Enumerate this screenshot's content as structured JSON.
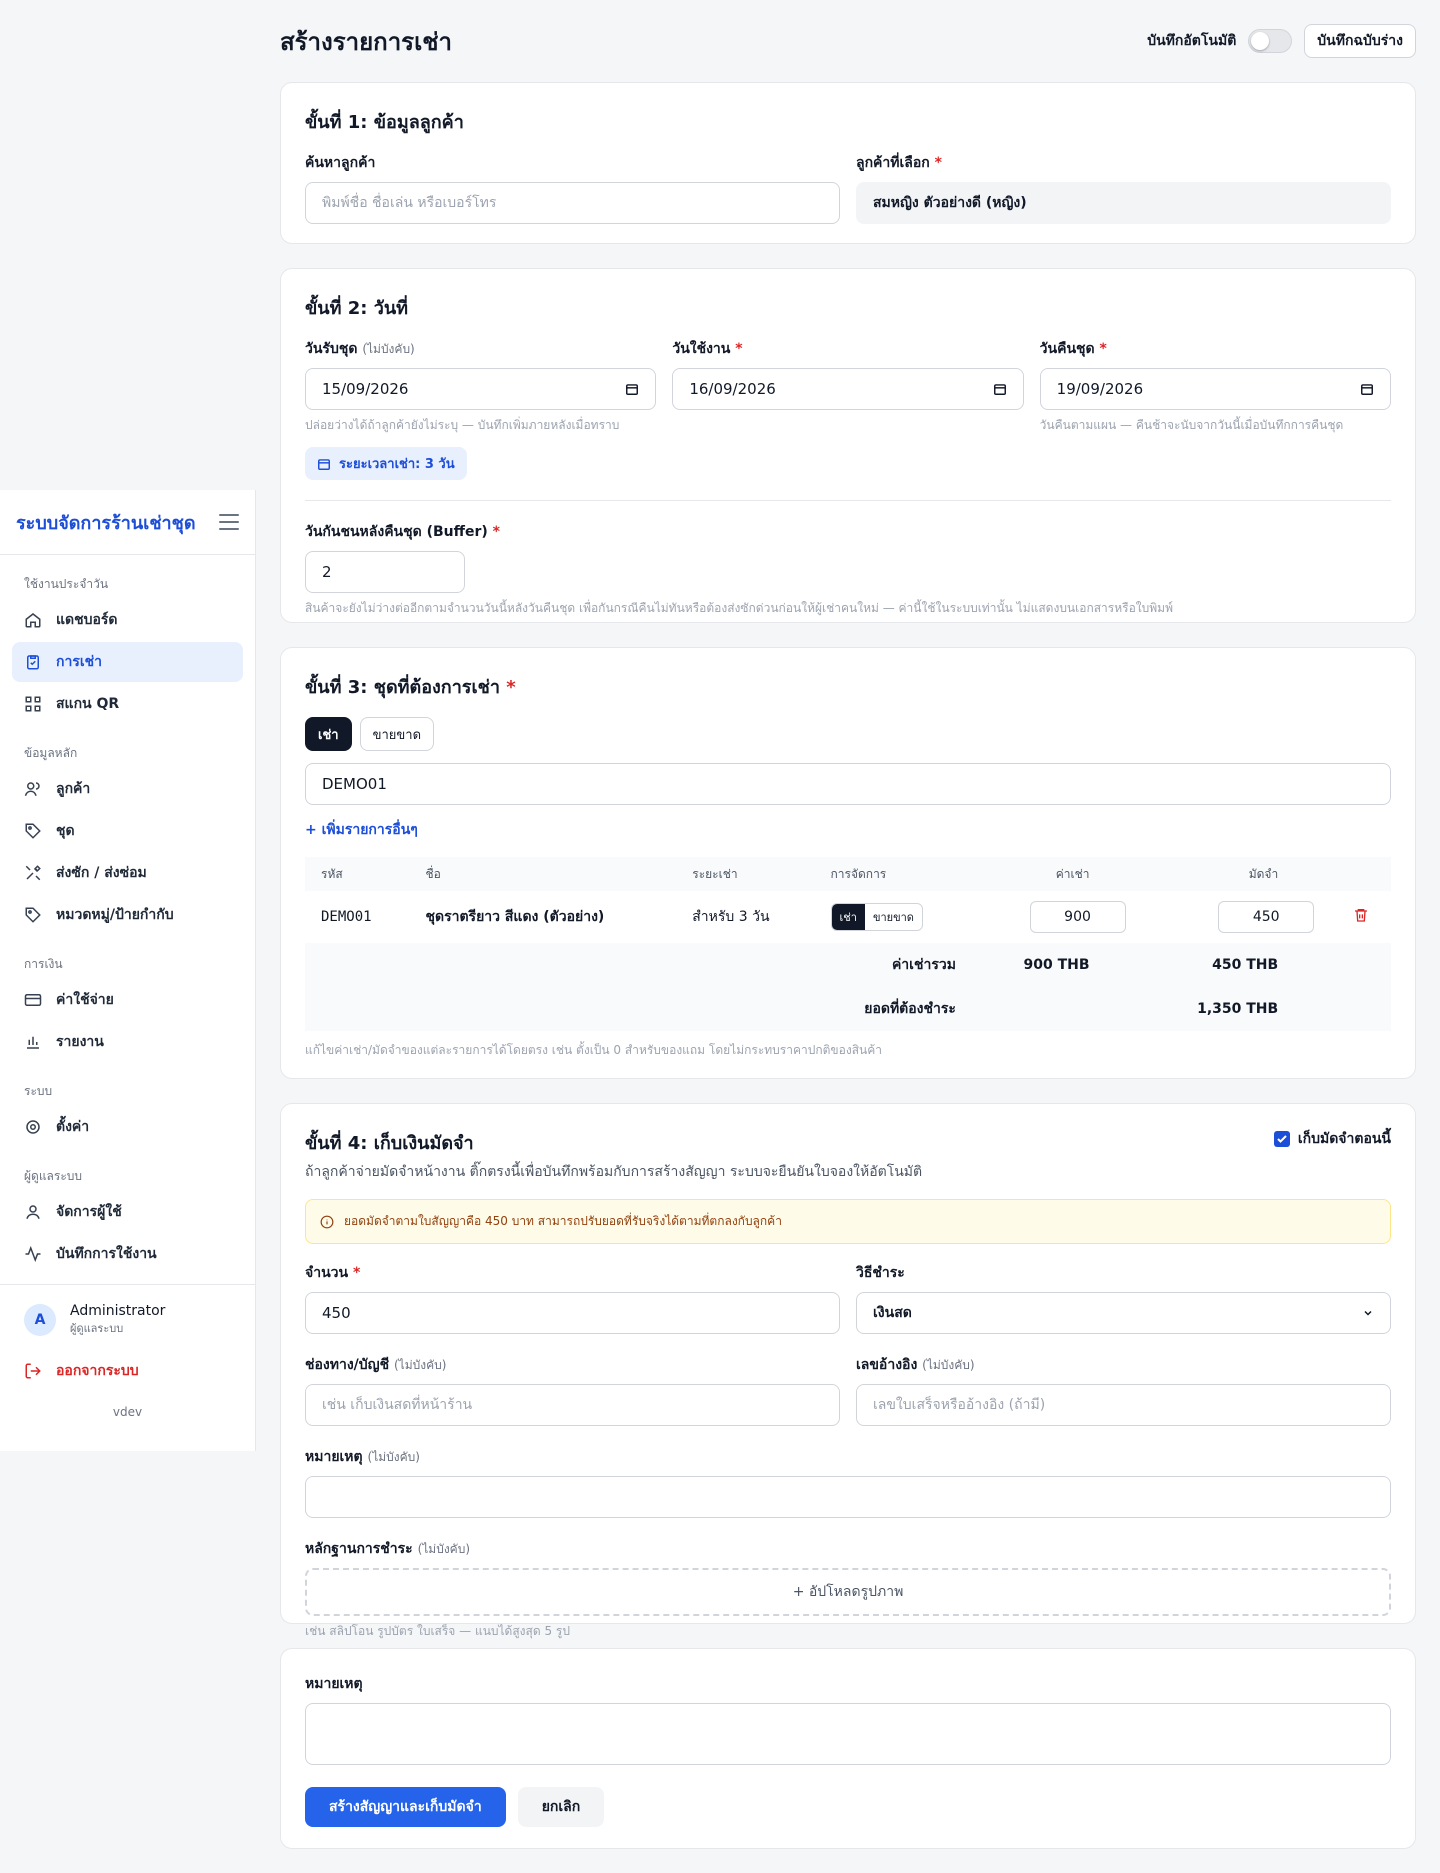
{
  "sidebar": {
    "brand": "ระบบจัดการร้านเช่าชุด",
    "sections": {
      "daily": "ใช้งานประจำวัน",
      "master": "ข้อมูลหลัก",
      "finance": "การเงิน",
      "system": "ระบบ",
      "admin": "ผู้ดูแลระบบ"
    },
    "items": {
      "dashboard": "แดชบอร์ด",
      "rentals": "การเช่า",
      "scan": "สแกน QR",
      "customers": "ลูกค้า",
      "dresses": "ชุด",
      "cleaning": "ส่งซัก / ส่งซ่อม",
      "categories": "หมวดหมู่/ป้ายกำกับ",
      "expenses": "ค่าใช้จ่าย",
      "reports": "รายงาน",
      "settings": "ตั้งค่า",
      "users": "จัดการผู้ใช้",
      "logs": "บันทึกการใช้งาน"
    },
    "user": {
      "initial": "A",
      "name": "Administrator",
      "role": "ผู้ดูแลระบบ"
    },
    "logout": "ออกจากระบบ",
    "version": "vdev"
  },
  "header": {
    "title": "สร้างรายการเช่า",
    "autosave": "บันทึกอัตโนมัติ",
    "save_draft": "บันทึกฉบับร่าง"
  },
  "step1": {
    "title": "ขั้นที่ 1: ข้อมูลลูกค้า",
    "search_label": "ค้นหาลูกค้า",
    "search_placeholder": "พิมพ์ชื่อ ชื่อเล่น หรือเบอร์โทร",
    "selected_label": "ลูกค้าที่เลือก",
    "selected_value": "สมหญิง ตัวอย่างดี (หญิง)"
  },
  "step2": {
    "title": "ขั้นที่ 2: วันที่",
    "pickup_label": "วันรับชุด",
    "optional": "(ไม่บังคับ)",
    "pickup_value": "15/09/2026",
    "pickup_hint": "ปล่อยว่างได้ถ้าลูกค้ายังไม่ระบุ — บันทึกเพิ่มภายหลังเมื่อทราบ",
    "use_label": "วันใช้งาน",
    "use_value": "16/09/2026",
    "return_label": "วันคืนชุด",
    "return_value": "19/09/2026",
    "return_hint": "วันคืนตามแผน — คืนช้าจะนับจากวันนี้เมื่อบันทึกการคืนชุด",
    "duration": "ระยะเวลาเช่า: 3 วัน",
    "buffer_label": "วันกันชนหลังคืนชุด (Buffer)",
    "buffer_value": "2",
    "buffer_hint": "สินค้าจะยังไม่ว่างต่ออีกตามจำนวนวันนี้หลังวันคืนชุด เพื่อกันกรณีคืนไม่ทันหรือต้องส่งซักด่วนก่อนให้ผู้เช่าคนใหม่ — ค่านี้ใช้ในระบบเท่านั้น ไม่แสดงบนเอกสารหรือใบพิมพ์"
  },
  "step3": {
    "title": "ขั้นที่ 3: ชุดที่ต้องการเช่า",
    "tab_rent": "เช่า",
    "tab_sell": "ขายขาด",
    "code_value": "DEMO01",
    "add_more": "+ เพิ่มรายการอื่นๆ",
    "columns": [
      "รหัส",
      "ชื่อ",
      "ระยะเช่า",
      "การจัดการ",
      "ค่าเช่า",
      "มัดจำ"
    ],
    "rows": [
      {
        "code": "DEMO01",
        "name": "ชุดราตรียาว สีแดง (ตัวอย่าง)",
        "period": "สำหรับ 3 วัน",
        "mode_rent": "เช่า",
        "mode_sell": "ขายขาด",
        "rent": "900",
        "deposit": "450"
      }
    ],
    "total_label": "ค่าเช่ารวม",
    "total_rent": "900 THB",
    "total_deposit": "450 THB",
    "due_label": "ยอดที่ต้องชำระ",
    "due_value": "1,350 THB",
    "hint": "แก้ไขค่าเช่า/มัดจำของแต่ละรายการได้โดยตรง เช่น ตั้งเป็น 0 สำหรับของแถม โดยไม่กระทบราคาปกติของสินค้า"
  },
  "step4": {
    "title": "ขั้นที่ 4: เก็บเงินมัดจำ",
    "subtitle": "ถ้าลูกค้าจ่ายมัดจำหน้างาน ติ๊กตรงนี้เพื่อบันทึกพร้อมกับการสร้างสัญญา ระบบจะยืนยันใบจองให้อัตโนมัติ",
    "collect_now": "เก็บมัดจำตอนนี้",
    "warning": "ยอดมัดจำตามใบสัญญาคือ 450 บาท สามารถปรับยอดที่รับจริงได้ตามที่ตกลงกับลูกค้า",
    "amount_label": "จำนวน",
    "amount_value": "450",
    "method_label": "วิธีชำระ",
    "method_value": "เงินสด",
    "channel_label": "ช่องทาง/บัญชี",
    "channel_placeholder": "เช่น เก็บเงินสดที่หน้าร้าน",
    "ref_label": "เลขอ้างอิง",
    "ref_placeholder": "เลขใบเสร็จหรืออ้างอิง (ถ้ามี)",
    "note_label": "หมายเหตุ",
    "proof_label": "หลักฐานการชำระ",
    "upload": "+ อัปโหลดรูปภาพ",
    "proof_hint": "เช่น สลิปโอน รูปบัตร ใบเสร็จ — แนบได้สูงสุด 5 รูป"
  },
  "footer": {
    "note_label": "หมายเหตุ",
    "create": "สร้างสัญญาและเก็บมัดจำ",
    "cancel": "ยกเลิก"
  }
}
